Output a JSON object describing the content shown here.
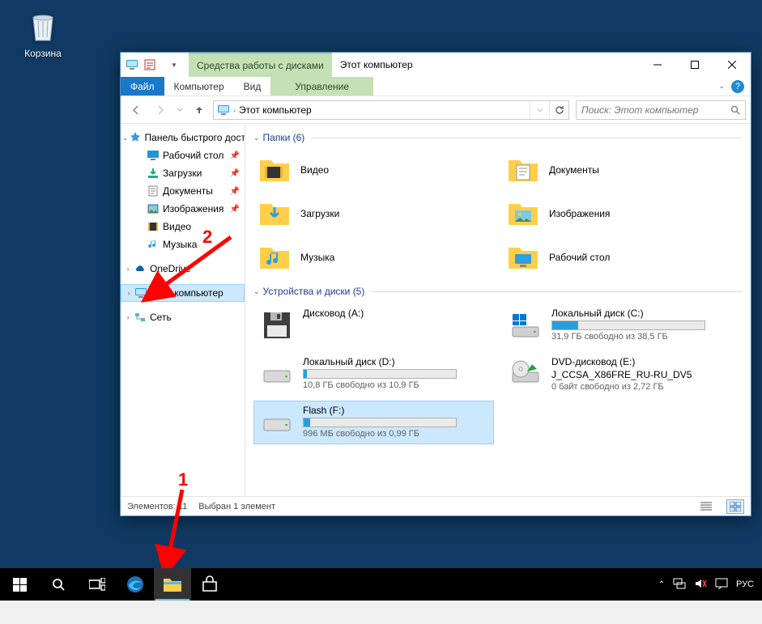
{
  "desktop": {
    "recycle_bin": "Корзина"
  },
  "window": {
    "qat_dropdown_label": "▾",
    "context_tab_group": "Средства работы с дисками",
    "title": "Этот компьютер",
    "ribbon": {
      "file": "Файл",
      "computer": "Компьютер",
      "view": "Вид",
      "manage": "Управление"
    },
    "nav": {
      "address_text": "Этот компьютер",
      "search_placeholder": "Поиск: Этот компьютер"
    }
  },
  "tree": {
    "quick_access": "Панель быстрого доступа",
    "desktop": "Рабочий стол",
    "downloads": "Загрузки",
    "documents": "Документы",
    "pictures": "Изображения",
    "videos": "Видео",
    "music": "Музыка",
    "onedrive": "OneDrive",
    "this_pc": "Этот компьютер",
    "network": "Сеть"
  },
  "groups": {
    "folders_header": "Папки (6)",
    "devices_header": "Устройства и диски (5)"
  },
  "folders": {
    "videos": "Видео",
    "documents": "Документы",
    "downloads": "Загрузки",
    "pictures": "Изображения",
    "music": "Музыка",
    "desktop": "Рабочий стол"
  },
  "drives": {
    "floppy": {
      "name": "Дисковод (A:)"
    },
    "c": {
      "name": "Локальный диск (C:)",
      "sub": "31,9 ГБ свободно из 38,5 ГБ",
      "used_pct": 17
    },
    "d": {
      "name": "Локальный диск (D:)",
      "sub": "10,8 ГБ свободно из 10,9 ГБ",
      "used_pct": 2
    },
    "dvd": {
      "name": "DVD-дисковод (E:)",
      "label": "J_CCSA_X86FRE_RU-RU_DV5",
      "sub": "0 байт свободно из 2,72 ГБ"
    },
    "f": {
      "name": "Flash (F:)",
      "sub": "996 МБ свободно из 0,99 ГБ",
      "used_pct": 4
    }
  },
  "status": {
    "count": "Элементов: 11",
    "selected": "Выбран 1 элемент"
  },
  "taskbar": {
    "lang": "РУС"
  },
  "annotations": {
    "one": "1",
    "two": "2"
  }
}
